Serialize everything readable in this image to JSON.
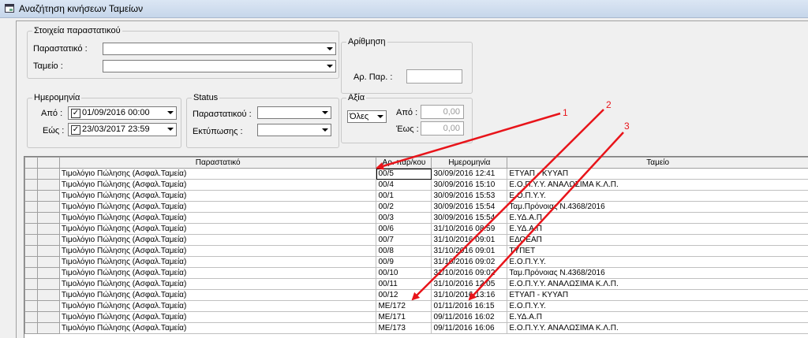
{
  "window": {
    "title": "Αναζήτηση κινήσεων Ταμείων"
  },
  "doc_group": {
    "legend": "Στοιχεία παραστατικού",
    "parastatiko_label": "Παραστατικό :",
    "parastatiko_value": "",
    "tameio_label": "Ταμείο :",
    "tameio_value": ""
  },
  "numbering": {
    "legend": "Αρίθμηση",
    "label": "Αρ. Παρ. :",
    "value": ""
  },
  "date_group": {
    "legend": "Ημερομηνία",
    "from_label": "Από :",
    "from_value": "01/09/2016 00:00",
    "to_label": "Εώς :",
    "to_value": "23/03/2017 23:59"
  },
  "status_group": {
    "legend": "Status",
    "doc_label": "Παραστατικού :",
    "doc_value": "",
    "print_label": "Εκτύπωσης :",
    "print_value": ""
  },
  "value_group": {
    "legend": "Αξία",
    "mode_value": "Όλες",
    "from_label": "Από :",
    "from_value": "0,00",
    "to_label": "Έως :",
    "to_value": "0,00"
  },
  "grid": {
    "columns": [
      "",
      "",
      "Παραστατικό",
      "Αρ. παρ/κου",
      "Ημερομηνία",
      "Ταμείο"
    ],
    "rows": [
      [
        "Τιμολόγιο Πώλησης (Ασφαλ.Ταμεία)",
        "00/5",
        "30/09/2016 12:41",
        "ΕΤΥΑΠ - ΚΥΥΑΠ"
      ],
      [
        "Τιμολόγιο Πώλησης (Ασφαλ.Ταμεία)",
        "00/4",
        "30/09/2016 15:10",
        "Ε.Ο.Π.Υ.Υ. ΑΝΑΛΩΣΙΜΑ Κ.Λ.Π."
      ],
      [
        "Τιμολόγιο Πώλησης (Ασφαλ.Ταμεία)",
        "00/1",
        "30/09/2016 15:53",
        "Ε.Ο.Π.Υ.Υ."
      ],
      [
        "Τιμολόγιο Πώλησης (Ασφαλ.Ταμεία)",
        "00/2",
        "30/09/2016 15:54",
        "Ταμ.Πρόνοιας Ν.4368/2016"
      ],
      [
        "Τιμολόγιο Πώλησης (Ασφαλ.Ταμεία)",
        "00/3",
        "30/09/2016 15:54",
        "Ε.ΥΔ.Α.Π"
      ],
      [
        "Τιμολόγιο Πώλησης (Ασφαλ.Ταμεία)",
        "00/6",
        "31/10/2016 08:59",
        "Ε.ΥΔ.Α.Π"
      ],
      [
        "Τιμολόγιο Πώλησης (Ασφαλ.Ταμεία)",
        "00/7",
        "31/10/2016 09:01",
        "ΕΔΟΕΑΠ"
      ],
      [
        "Τιμολόγιο Πώλησης (Ασφαλ.Ταμεία)",
        "00/8",
        "31/10/2016 09:01",
        "ΤΥΠΕΤ"
      ],
      [
        "Τιμολόγιο Πώλησης (Ασφαλ.Ταμεία)",
        "00/9",
        "31/10/2016 09:02",
        "Ε.Ο.Π.Υ.Υ."
      ],
      [
        "Τιμολόγιο Πώλησης (Ασφαλ.Ταμεία)",
        "00/10",
        "31/10/2016 09:02",
        "Ταμ.Πρόνοιας Ν.4368/2016"
      ],
      [
        "Τιμολόγιο Πώλησης (Ασφαλ.Ταμεία)",
        "00/11",
        "31/10/2016 12:05",
        "Ε.Ο.Π.Υ.Υ. ΑΝΑΛΩΣΙΜΑ Κ.Λ.Π."
      ],
      [
        "Τιμολόγιο Πώλησης (Ασφαλ.Ταμεία)",
        "00/12",
        "31/10/2016 13:16",
        "ΕΤΥΑΠ - ΚΥΥΑΠ"
      ],
      [
        "Τιμολόγιο Πώλησης (Ασφαλ.Ταμεία)",
        "ΜΕ/172",
        "01/11/2016 16:15",
        "Ε.Ο.Π.Υ.Υ."
      ],
      [
        "Τιμολόγιο Πώλησης (Ασφαλ.Ταμεία)",
        "ΜΕ/171",
        "09/11/2016 16:02",
        "Ε.ΥΔ.Α.Π"
      ],
      [
        "Τιμολόγιο Πώλησης (Ασφαλ.Ταμεία)",
        "ΜΕ/173",
        "09/11/2016 16:06",
        "Ε.Ο.Π.Υ.Υ. ΑΝΑΛΩΣΙΜΑ Κ.Λ.Π."
      ]
    ]
  },
  "annotations": {
    "labels": [
      "1",
      "2",
      "3"
    ],
    "color": "#e8141a"
  }
}
